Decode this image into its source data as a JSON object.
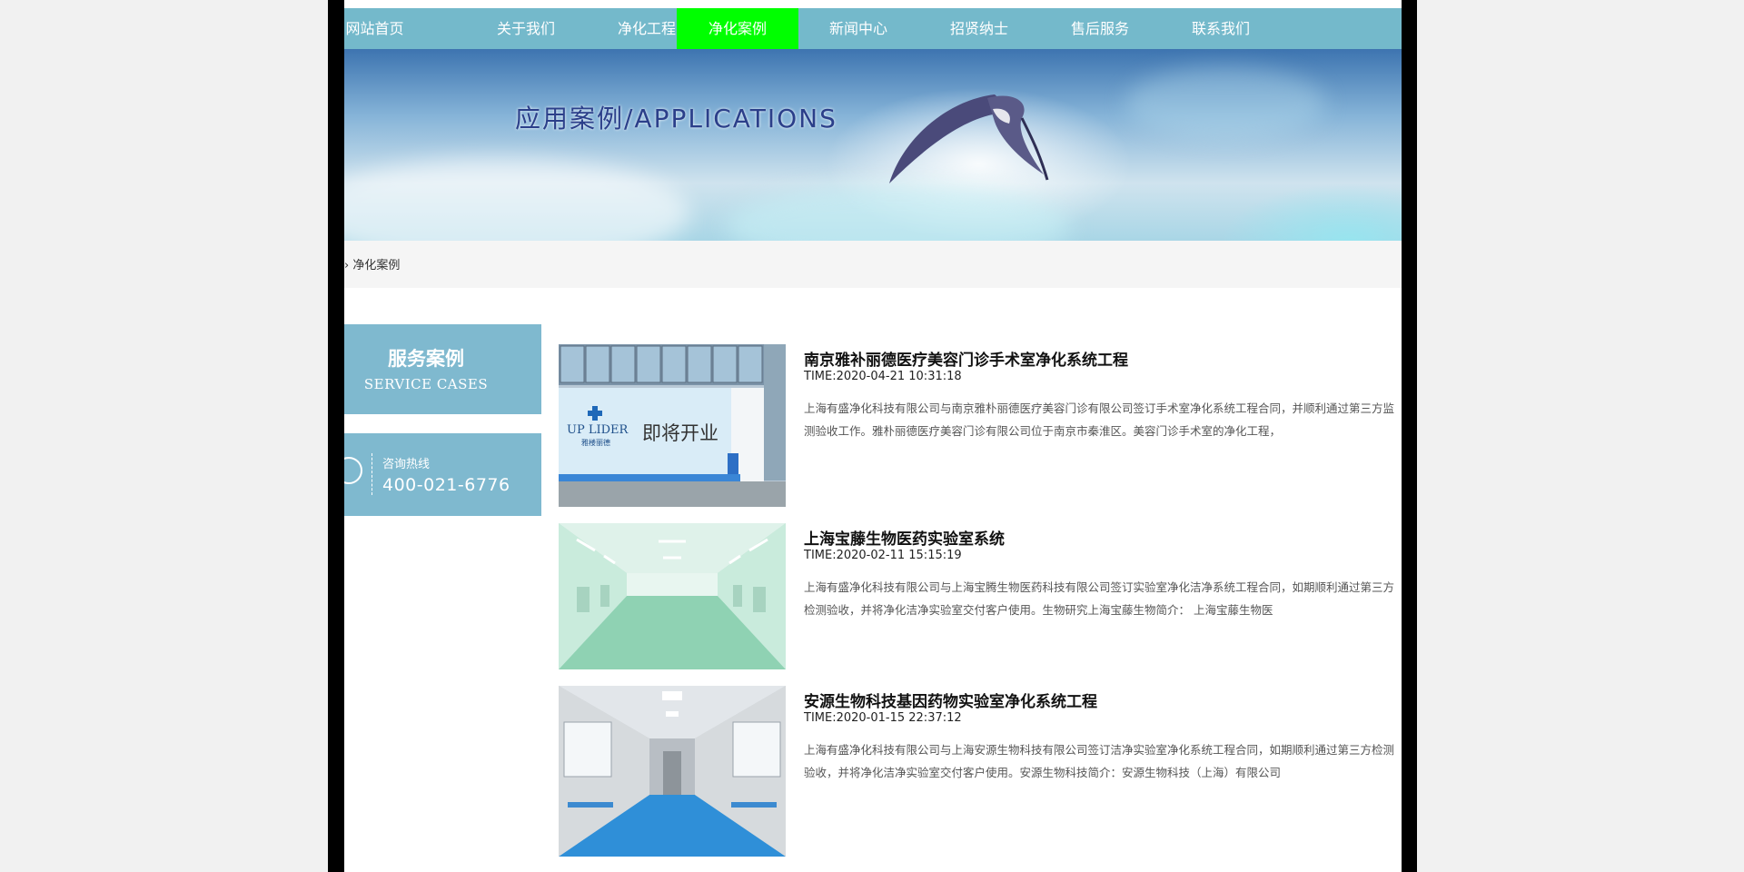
{
  "nav": {
    "items": [
      {
        "label": "网站首页"
      },
      {
        "label": "关于我们"
      },
      {
        "label": "净化工程"
      },
      {
        "label": "净化案例",
        "active": true
      },
      {
        "label": "新闻中心"
      },
      {
        "label": "招贤纳士"
      },
      {
        "label": "售后服务"
      },
      {
        "label": "联系我们"
      }
    ],
    "active_color": "#00ff00",
    "bar_color": "#74b9cb"
  },
  "banner": {
    "title": "应用案例/APPLICATIONS"
  },
  "breadcrumb": {
    "text": "› 净化案例"
  },
  "sidebar": {
    "title": "服务案例",
    "subtitle": "SERVICE CASES",
    "contact_label": "咨询热线",
    "phone": "400-021-6776",
    "accent_color": "#7fb9cf"
  },
  "cases": [
    {
      "title": "南京雅补丽德医疗美容门诊手术室净化系统工程",
      "time": "TIME:2020-04-21 10:31:18",
      "desc": "上海有盛净化科技有限公司与南京雅朴丽德医疗美容门诊有限公司签订手术室净化系统工程合同，并顺利通过第三方监测验收工作。雅朴丽德医疗美容门诊有限公司位于南京市秦淮区。美容门诊手术室的净化工程，",
      "image": {
        "brand": "UP LIDER",
        "brand_cn": "雅楼丽德",
        "slogan": "即将开业"
      }
    },
    {
      "title": "上海宝藤生物医药实验室系统",
      "time": "TIME:2020-02-11 15:15:19",
      "desc": "上海有盛净化科技有限公司与上海宝腾生物医药科技有限公司签订实验室净化洁净系统工程合同，如期顺利通过第三方检测验收，并将净化洁净实验室交付客户使用。生物研究上海宝藤生物简介： 上海宝藤生物医"
    },
    {
      "title": "安源生物科技基因药物实验室净化系统工程",
      "time": "TIME:2020-01-15 22:37:12",
      "desc": "上海有盛净化科技有限公司与上海安源生物科技有限公司签订洁净实验室净化系统工程合同，如期顺利通过第三方检测验收，并将净化洁净实验室交付客户使用。安源生物科技简介：安源生物科技（上海）有限公司"
    }
  ]
}
